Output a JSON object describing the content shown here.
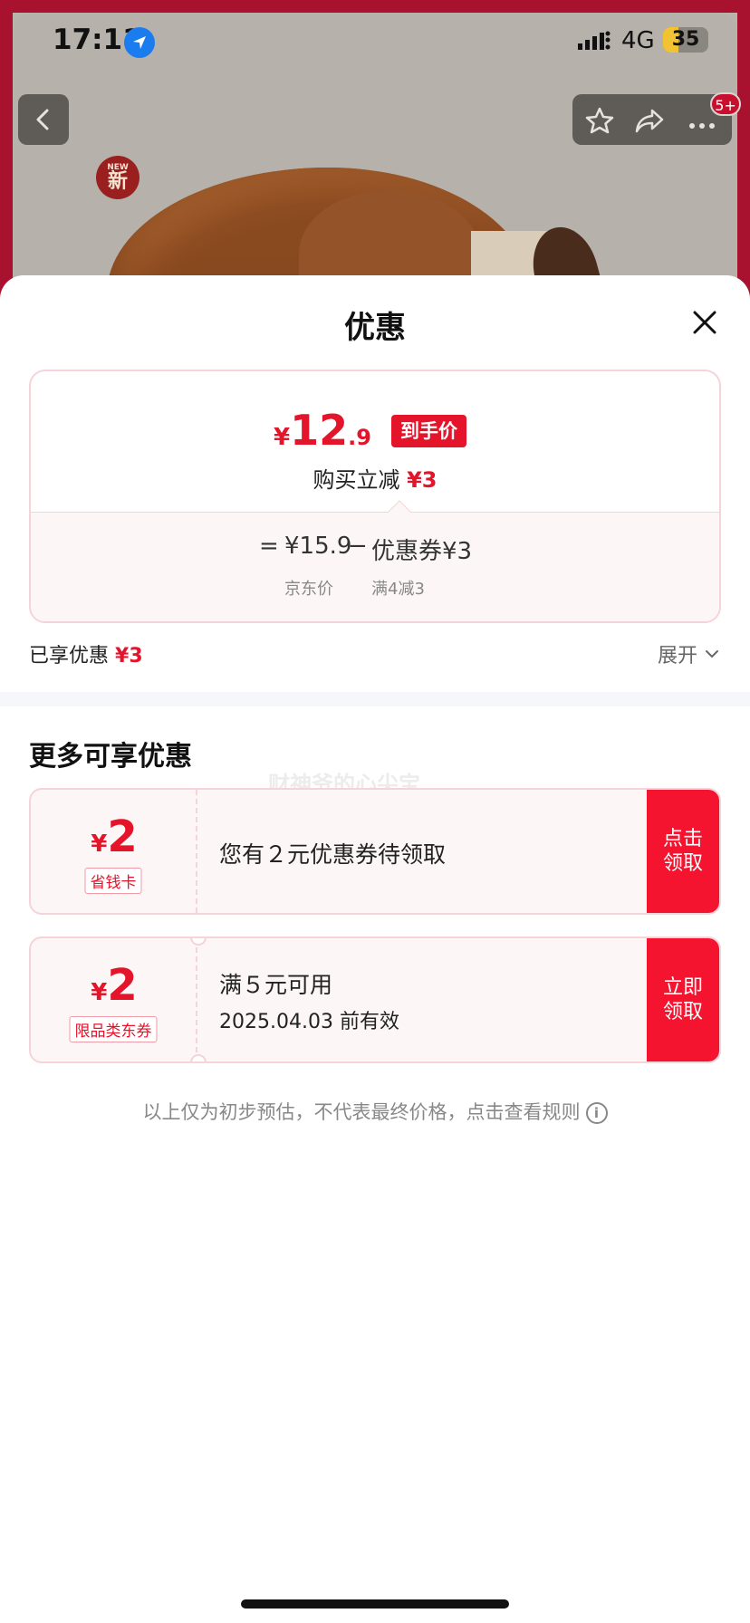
{
  "status_bar": {
    "time": "17:11",
    "network": "4G",
    "battery": "35"
  },
  "header": {
    "more_badge": "5+",
    "new_badge": "新",
    "new_badge_small": "NEW"
  },
  "sheet": {
    "title": "优惠"
  },
  "price_card": {
    "yen": "¥",
    "price_int": "12",
    "price_dec": ".9",
    "tag": "到手价",
    "reduce_label": "购买立减",
    "reduce_value": "¥3",
    "eq": "=",
    "jd_price": "¥15.9",
    "minus": "−",
    "coupon_text": "优惠券¥3",
    "jd_price_label": "京东价",
    "coupon_rule": "满4减3"
  },
  "enjoyed": {
    "label": "已享优惠",
    "value": "¥3",
    "expand": "展开"
  },
  "more": {
    "title": "更多可享优惠",
    "watermark": "财神爷的心尖宝"
  },
  "coupons": [
    {
      "yen": "¥",
      "amount": "2",
      "tag": "省钱卡",
      "desc": "您有２元优惠券待领取",
      "desc2": "",
      "button": "点击领取"
    },
    {
      "yen": "¥",
      "amount": "2",
      "tag": "限品类东券",
      "desc": "满５元可用",
      "desc2": "2025.04.03 前有效",
      "button": "立即领取"
    }
  ],
  "disclaimer": {
    "text": "以上仅为初步预估，不代表最终价格，点击查看规则",
    "info_icon": "i"
  },
  "colors": {
    "accent": "#e4142b",
    "button": "#f5142f"
  }
}
